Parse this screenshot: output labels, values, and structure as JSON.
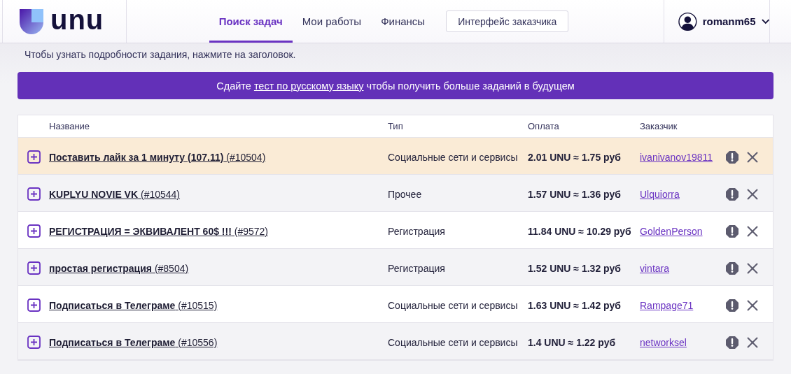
{
  "header": {
    "logo_text": "unu",
    "tabs": [
      {
        "label": "Поиск задач",
        "selected": true
      },
      {
        "label": "Мои работы",
        "selected": false
      },
      {
        "label": "Финансы",
        "selected": false
      }
    ],
    "client_button": "Интерфейс заказчика",
    "user": "romanm65"
  },
  "intro": "Чтобы узнать подробности задания, нажмите на заголовок.",
  "banner": {
    "before": "Сдайте ",
    "link": "тест по русскому языку",
    "after": " чтобы получить больше заданий в будущем"
  },
  "table": {
    "columns": [
      "Название",
      "Тип",
      "Оплата",
      "Заказчик"
    ],
    "rows": [
      {
        "title": "**Поставить лайк за 1 минуту (107.11)** (#10504)",
        "type": "Социальные сети и сервисы",
        "pay": "2.01 UNU ≈ 1.75 руб",
        "customer": "ivanivanov19811",
        "highlighted": true
      },
      {
        "title": "**KUPLYU NOVIE VK** (#10544)",
        "type": "Прочее",
        "pay": "1.57 UNU ≈ 1.36 руб",
        "customer": "Ulquiorra",
        "highlighted": false
      },
      {
        "title": "**РЕГИСТРАЦИЯ = ЭКВИВАЛЕНТ 60$ !!!** (#9572)",
        "type": "Регистрация",
        "pay": "11.84 UNU ≈ 10.29 руб",
        "customer": "GoldenPerson",
        "highlighted": false
      },
      {
        "title": "**простая регистрация** (#8504)",
        "type": "Регистрация",
        "pay": "1.52 UNU ≈ 1.32 руб",
        "customer": "vintara",
        "highlighted": false
      },
      {
        "title": "**Подписаться в Телеграме** (#10515)",
        "type": "Социальные сети и сервисы",
        "pay": "1.63 UNU ≈ 1.42 руб",
        "customer": "Rampage71",
        "highlighted": false
      },
      {
        "title": "**Подписаться в Телеграме** (#10556)",
        "type": "Социальные сети и сервисы",
        "pay": "1.4 UNU ≈ 1.22 руб",
        "customer": "networksel",
        "highlighted": false
      }
    ]
  }
}
